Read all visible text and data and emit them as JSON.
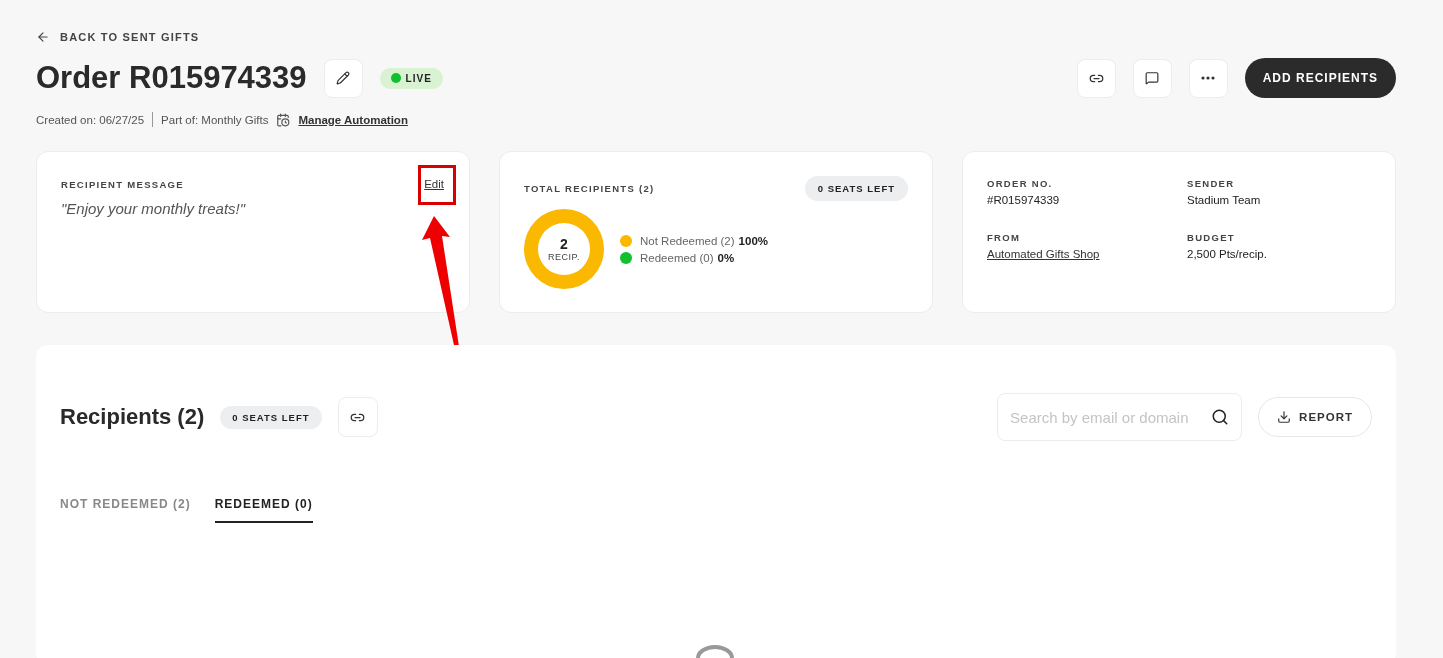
{
  "back_link": "BACK TO SENT GIFTS",
  "title": "Order R015974339",
  "status": {
    "label": "LIVE",
    "live": true
  },
  "meta": {
    "created": "Created on: 06/27/25",
    "part_of": "Part of: Monthly Gifts",
    "automation_link": "Manage Automation"
  },
  "primary_button": "ADD RECIPIENTS",
  "message_card": {
    "label": "RECIPIENT MESSAGE",
    "edit": "Edit",
    "message": "\"Enjoy your monthly treats!\"",
    "highlighted": true
  },
  "recipients_card": {
    "label": "TOTAL RECIPIENTS (2)",
    "seats": "0 SEATS LEFT",
    "center_value": "2",
    "center_label": "RECIP.",
    "legend": [
      {
        "label": "Not Redeemed (2)",
        "percent": "100%",
        "color": "#fbb800"
      },
      {
        "label": "Redeemed (0)",
        "percent": "0%",
        "color": "#10c02f"
      }
    ]
  },
  "details_card": [
    {
      "label": "ORDER NO.",
      "value": "#R015974339",
      "kind": "text"
    },
    {
      "label": "SENDER",
      "value": "Stadium Team",
      "kind": "text"
    },
    {
      "label": "FROM",
      "value": "Automated Gifts Shop",
      "kind": "link"
    },
    {
      "label": "BUDGET",
      "value": "2,500 Pts/recip.",
      "kind": "text"
    }
  ],
  "recipients_panel": {
    "title": "Recipients (2)",
    "seats": "0 SEATS LEFT",
    "search": {
      "placeholder": "Search by email or domain"
    },
    "report_button": "REPORT",
    "tabs": [
      {
        "label": "NOT REDEEMED (2)",
        "selected": false
      },
      {
        "label": "REDEEMED (0)",
        "selected": true
      }
    ]
  }
}
